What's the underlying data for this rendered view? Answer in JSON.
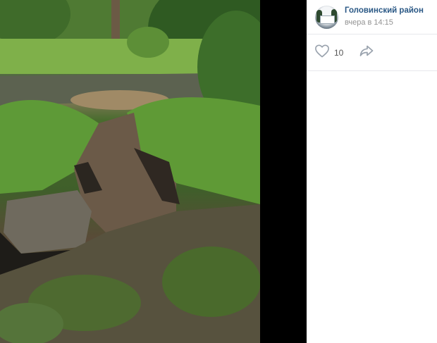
{
  "post": {
    "author": "Головинский район",
    "time": "вчера в 14:15",
    "likes": "10"
  },
  "icons": {
    "like": "heart-icon",
    "share": "share-arrow-icon"
  },
  "colors": {
    "link": "#2a5885",
    "muted": "#939393",
    "divider": "#e7e8ec"
  }
}
